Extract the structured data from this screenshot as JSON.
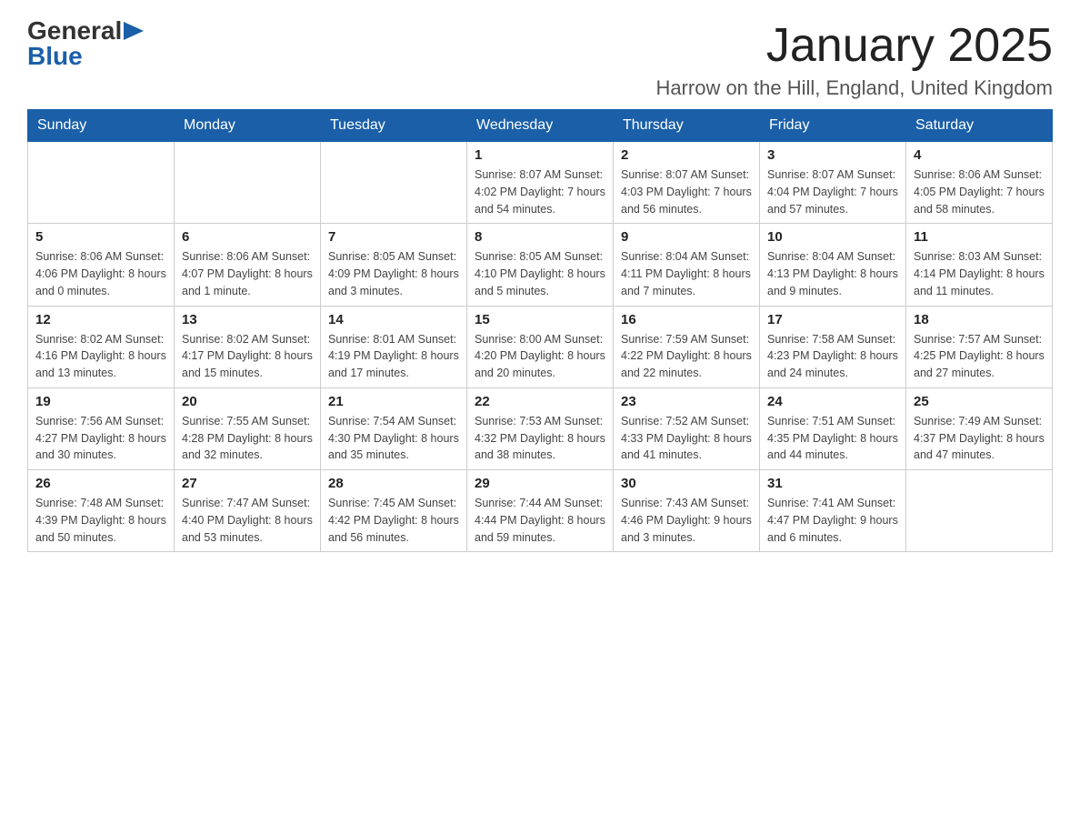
{
  "header": {
    "logo_general": "General",
    "logo_blue": "Blue",
    "month_title": "January 2025",
    "location": "Harrow on the Hill, England, United Kingdom"
  },
  "calendar": {
    "days_of_week": [
      "Sunday",
      "Monday",
      "Tuesday",
      "Wednesday",
      "Thursday",
      "Friday",
      "Saturday"
    ],
    "weeks": [
      [
        {
          "day": "",
          "info": ""
        },
        {
          "day": "",
          "info": ""
        },
        {
          "day": "",
          "info": ""
        },
        {
          "day": "1",
          "info": "Sunrise: 8:07 AM\nSunset: 4:02 PM\nDaylight: 7 hours\nand 54 minutes."
        },
        {
          "day": "2",
          "info": "Sunrise: 8:07 AM\nSunset: 4:03 PM\nDaylight: 7 hours\nand 56 minutes."
        },
        {
          "day": "3",
          "info": "Sunrise: 8:07 AM\nSunset: 4:04 PM\nDaylight: 7 hours\nand 57 minutes."
        },
        {
          "day": "4",
          "info": "Sunrise: 8:06 AM\nSunset: 4:05 PM\nDaylight: 7 hours\nand 58 minutes."
        }
      ],
      [
        {
          "day": "5",
          "info": "Sunrise: 8:06 AM\nSunset: 4:06 PM\nDaylight: 8 hours\nand 0 minutes."
        },
        {
          "day": "6",
          "info": "Sunrise: 8:06 AM\nSunset: 4:07 PM\nDaylight: 8 hours\nand 1 minute."
        },
        {
          "day": "7",
          "info": "Sunrise: 8:05 AM\nSunset: 4:09 PM\nDaylight: 8 hours\nand 3 minutes."
        },
        {
          "day": "8",
          "info": "Sunrise: 8:05 AM\nSunset: 4:10 PM\nDaylight: 8 hours\nand 5 minutes."
        },
        {
          "day": "9",
          "info": "Sunrise: 8:04 AM\nSunset: 4:11 PM\nDaylight: 8 hours\nand 7 minutes."
        },
        {
          "day": "10",
          "info": "Sunrise: 8:04 AM\nSunset: 4:13 PM\nDaylight: 8 hours\nand 9 minutes."
        },
        {
          "day": "11",
          "info": "Sunrise: 8:03 AM\nSunset: 4:14 PM\nDaylight: 8 hours\nand 11 minutes."
        }
      ],
      [
        {
          "day": "12",
          "info": "Sunrise: 8:02 AM\nSunset: 4:16 PM\nDaylight: 8 hours\nand 13 minutes."
        },
        {
          "day": "13",
          "info": "Sunrise: 8:02 AM\nSunset: 4:17 PM\nDaylight: 8 hours\nand 15 minutes."
        },
        {
          "day": "14",
          "info": "Sunrise: 8:01 AM\nSunset: 4:19 PM\nDaylight: 8 hours\nand 17 minutes."
        },
        {
          "day": "15",
          "info": "Sunrise: 8:00 AM\nSunset: 4:20 PM\nDaylight: 8 hours\nand 20 minutes."
        },
        {
          "day": "16",
          "info": "Sunrise: 7:59 AM\nSunset: 4:22 PM\nDaylight: 8 hours\nand 22 minutes."
        },
        {
          "day": "17",
          "info": "Sunrise: 7:58 AM\nSunset: 4:23 PM\nDaylight: 8 hours\nand 24 minutes."
        },
        {
          "day": "18",
          "info": "Sunrise: 7:57 AM\nSunset: 4:25 PM\nDaylight: 8 hours\nand 27 minutes."
        }
      ],
      [
        {
          "day": "19",
          "info": "Sunrise: 7:56 AM\nSunset: 4:27 PM\nDaylight: 8 hours\nand 30 minutes."
        },
        {
          "day": "20",
          "info": "Sunrise: 7:55 AM\nSunset: 4:28 PM\nDaylight: 8 hours\nand 32 minutes."
        },
        {
          "day": "21",
          "info": "Sunrise: 7:54 AM\nSunset: 4:30 PM\nDaylight: 8 hours\nand 35 minutes."
        },
        {
          "day": "22",
          "info": "Sunrise: 7:53 AM\nSunset: 4:32 PM\nDaylight: 8 hours\nand 38 minutes."
        },
        {
          "day": "23",
          "info": "Sunrise: 7:52 AM\nSunset: 4:33 PM\nDaylight: 8 hours\nand 41 minutes."
        },
        {
          "day": "24",
          "info": "Sunrise: 7:51 AM\nSunset: 4:35 PM\nDaylight: 8 hours\nand 44 minutes."
        },
        {
          "day": "25",
          "info": "Sunrise: 7:49 AM\nSunset: 4:37 PM\nDaylight: 8 hours\nand 47 minutes."
        }
      ],
      [
        {
          "day": "26",
          "info": "Sunrise: 7:48 AM\nSunset: 4:39 PM\nDaylight: 8 hours\nand 50 minutes."
        },
        {
          "day": "27",
          "info": "Sunrise: 7:47 AM\nSunset: 4:40 PM\nDaylight: 8 hours\nand 53 minutes."
        },
        {
          "day": "28",
          "info": "Sunrise: 7:45 AM\nSunset: 4:42 PM\nDaylight: 8 hours\nand 56 minutes."
        },
        {
          "day": "29",
          "info": "Sunrise: 7:44 AM\nSunset: 4:44 PM\nDaylight: 8 hours\nand 59 minutes."
        },
        {
          "day": "30",
          "info": "Sunrise: 7:43 AM\nSunset: 4:46 PM\nDaylight: 9 hours\nand 3 minutes."
        },
        {
          "day": "31",
          "info": "Sunrise: 7:41 AM\nSunset: 4:47 PM\nDaylight: 9 hours\nand 6 minutes."
        },
        {
          "day": "",
          "info": ""
        }
      ]
    ]
  }
}
